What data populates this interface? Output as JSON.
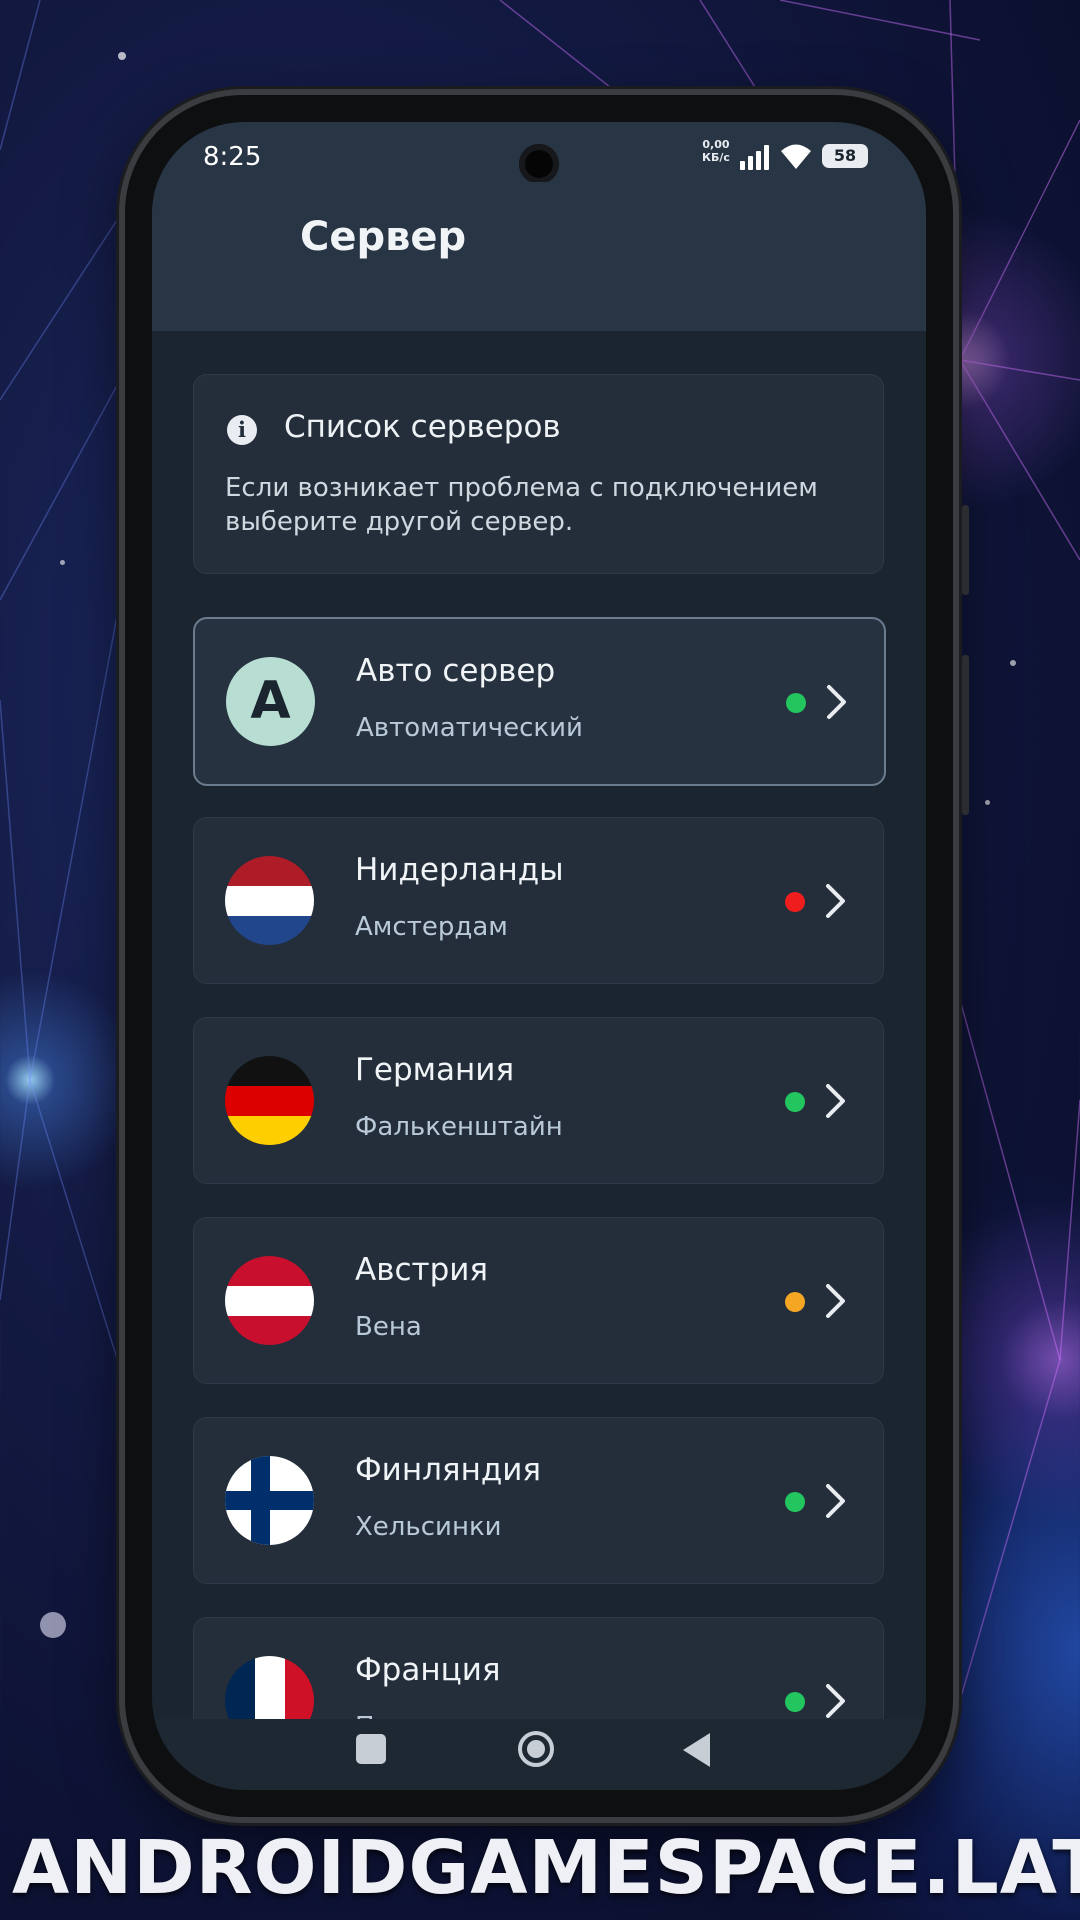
{
  "status_bar": {
    "time": "8:25",
    "net_speed_value": "0,00",
    "net_speed_unit": "КБ/с",
    "battery": "58"
  },
  "app_bar": {
    "title": "Сервер",
    "menu_icon": "hamburger-menu-icon"
  },
  "info_card": {
    "icon": "info-icon",
    "title": "Список серверов",
    "text": "Если возникает проблема с подключением выберите другой сервер."
  },
  "servers": [
    {
      "name": "Авто сервер",
      "city": "Автоматический",
      "avatar_letter": "A",
      "flag": "auto",
      "status_color": "#22c55e",
      "selected": true
    },
    {
      "name": "Нидерланды",
      "city": "Амстердам",
      "flag": "netherlands",
      "status_color": "#ef1d1d"
    },
    {
      "name": "Германия",
      "city": "Фалькенштайн",
      "flag": "germany",
      "status_color": "#22c55e"
    },
    {
      "name": "Австрия",
      "city": "Вена",
      "flag": "austria",
      "status_color": "#f5a623"
    },
    {
      "name": "Финляндия",
      "city": "Хельсинки",
      "flag": "finland",
      "status_color": "#22c55e"
    },
    {
      "name": "Франция",
      "city": "Париж",
      "flag": "france",
      "status_color": "#22c55e"
    }
  ],
  "nav_bar": {
    "recent_icon": "square-icon",
    "home_icon": "circle-home-icon",
    "back_icon": "triangle-back-icon"
  },
  "watermark": "ANDROIDGAMESPACE.LAT",
  "colors": {
    "screen_bg": "#1b2530",
    "app_bar_bg": "#283544",
    "card_bg": "#232e3a",
    "auto_avatar": "#b8ded4",
    "status_online": "#22c55e",
    "status_offline": "#ef1d1d",
    "status_busy": "#f5a623"
  }
}
